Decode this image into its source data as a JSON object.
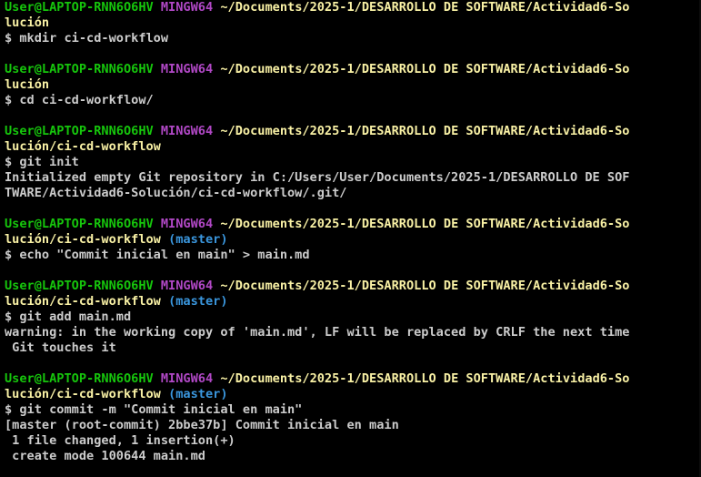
{
  "colors": {
    "background": "#000000",
    "user_host": "#16c60c",
    "shell": "#b148c6",
    "path": "#f9f1a5",
    "branch": "#3a96dd",
    "text": "#cccccc"
  },
  "lines": [
    {
      "type": "prompt",
      "segments": [
        {
          "text": "User@LAPTOP-RNN6O6HV",
          "role": "user_host"
        },
        {
          "text": " ",
          "role": "text"
        },
        {
          "text": "MINGW64",
          "role": "shell"
        },
        {
          "text": " ",
          "role": "text"
        },
        {
          "text": "~/Documents/2025-1/DESARROLLO DE SOFTWARE/Actividad6-So",
          "role": "path"
        }
      ]
    },
    {
      "type": "prompt",
      "segments": [
        {
          "text": "lución",
          "role": "path"
        }
      ]
    },
    {
      "type": "command",
      "segments": [
        {
          "text": "$ mkdir ci-cd-workflow",
          "role": "text"
        }
      ]
    },
    {
      "type": "blank",
      "segments": []
    },
    {
      "type": "prompt",
      "segments": [
        {
          "text": "User@LAPTOP-RNN6O6HV",
          "role": "user_host"
        },
        {
          "text": " ",
          "role": "text"
        },
        {
          "text": "MINGW64",
          "role": "shell"
        },
        {
          "text": " ",
          "role": "text"
        },
        {
          "text": "~/Documents/2025-1/DESARROLLO DE SOFTWARE/Actividad6-So",
          "role": "path"
        }
      ]
    },
    {
      "type": "prompt",
      "segments": [
        {
          "text": "lución",
          "role": "path"
        }
      ]
    },
    {
      "type": "command",
      "segments": [
        {
          "text": "$ cd ci-cd-workflow/",
          "role": "text"
        }
      ]
    },
    {
      "type": "blank",
      "segments": []
    },
    {
      "type": "prompt",
      "segments": [
        {
          "text": "User@LAPTOP-RNN6O6HV",
          "role": "user_host"
        },
        {
          "text": " ",
          "role": "text"
        },
        {
          "text": "MINGW64",
          "role": "shell"
        },
        {
          "text": " ",
          "role": "text"
        },
        {
          "text": "~/Documents/2025-1/DESARROLLO DE SOFTWARE/Actividad6-So",
          "role": "path"
        }
      ]
    },
    {
      "type": "prompt",
      "segments": [
        {
          "text": "lución/ci-cd-workflow",
          "role": "path"
        }
      ]
    },
    {
      "type": "command",
      "segments": [
        {
          "text": "$ git init",
          "role": "text"
        }
      ]
    },
    {
      "type": "output",
      "segments": [
        {
          "text": "Initialized empty Git repository in C:/Users/User/Documents/2025-1/DESARROLLO DE SOF",
          "role": "text"
        }
      ]
    },
    {
      "type": "output",
      "segments": [
        {
          "text": "TWARE/Actividad6-Solución/ci-cd-workflow/.git/",
          "role": "text"
        }
      ]
    },
    {
      "type": "blank",
      "segments": []
    },
    {
      "type": "prompt",
      "segments": [
        {
          "text": "User@LAPTOP-RNN6O6HV",
          "role": "user_host"
        },
        {
          "text": " ",
          "role": "text"
        },
        {
          "text": "MINGW64",
          "role": "shell"
        },
        {
          "text": " ",
          "role": "text"
        },
        {
          "text": "~/Documents/2025-1/DESARROLLO DE SOFTWARE/Actividad6-So",
          "role": "path"
        }
      ]
    },
    {
      "type": "prompt",
      "segments": [
        {
          "text": "lución/ci-cd-workflow",
          "role": "path"
        },
        {
          "text": " ",
          "role": "text"
        },
        {
          "text": "(master)",
          "role": "branch"
        }
      ]
    },
    {
      "type": "command",
      "segments": [
        {
          "text": "$ echo \"Commit inicial en main\" > main.md",
          "role": "text"
        }
      ]
    },
    {
      "type": "blank",
      "segments": []
    },
    {
      "type": "prompt",
      "segments": [
        {
          "text": "User@LAPTOP-RNN6O6HV",
          "role": "user_host"
        },
        {
          "text": " ",
          "role": "text"
        },
        {
          "text": "MINGW64",
          "role": "shell"
        },
        {
          "text": " ",
          "role": "text"
        },
        {
          "text": "~/Documents/2025-1/DESARROLLO DE SOFTWARE/Actividad6-So",
          "role": "path"
        }
      ]
    },
    {
      "type": "prompt",
      "segments": [
        {
          "text": "lución/ci-cd-workflow",
          "role": "path"
        },
        {
          "text": " ",
          "role": "text"
        },
        {
          "text": "(master)",
          "role": "branch"
        }
      ]
    },
    {
      "type": "command",
      "segments": [
        {
          "text": "$ git add main.md",
          "role": "text"
        }
      ]
    },
    {
      "type": "output",
      "segments": [
        {
          "text": "warning: in the working copy of 'main.md', LF will be replaced by CRLF the next time",
          "role": "text"
        }
      ]
    },
    {
      "type": "output",
      "segments": [
        {
          "text": " Git touches it",
          "role": "text"
        }
      ]
    },
    {
      "type": "blank",
      "segments": []
    },
    {
      "type": "prompt",
      "segments": [
        {
          "text": "User@LAPTOP-RNN6O6HV",
          "role": "user_host"
        },
        {
          "text": " ",
          "role": "text"
        },
        {
          "text": "MINGW64",
          "role": "shell"
        },
        {
          "text": " ",
          "role": "text"
        },
        {
          "text": "~/Documents/2025-1/DESARROLLO DE SOFTWARE/Actividad6-So",
          "role": "path"
        }
      ]
    },
    {
      "type": "prompt",
      "segments": [
        {
          "text": "lución/ci-cd-workflow",
          "role": "path"
        },
        {
          "text": " ",
          "role": "text"
        },
        {
          "text": "(master)",
          "role": "branch"
        }
      ]
    },
    {
      "type": "command",
      "segments": [
        {
          "text": "$ git commit -m \"Commit inicial en main\"",
          "role": "text"
        }
      ]
    },
    {
      "type": "output",
      "segments": [
        {
          "text": "[master (root-commit) 2bbe37b] Commit inicial en main",
          "role": "text"
        }
      ]
    },
    {
      "type": "output",
      "segments": [
        {
          "text": " 1 file changed, 1 insertion(+)",
          "role": "text"
        }
      ]
    },
    {
      "type": "output",
      "segments": [
        {
          "text": " create mode 100644 main.md",
          "role": "text"
        }
      ]
    }
  ]
}
